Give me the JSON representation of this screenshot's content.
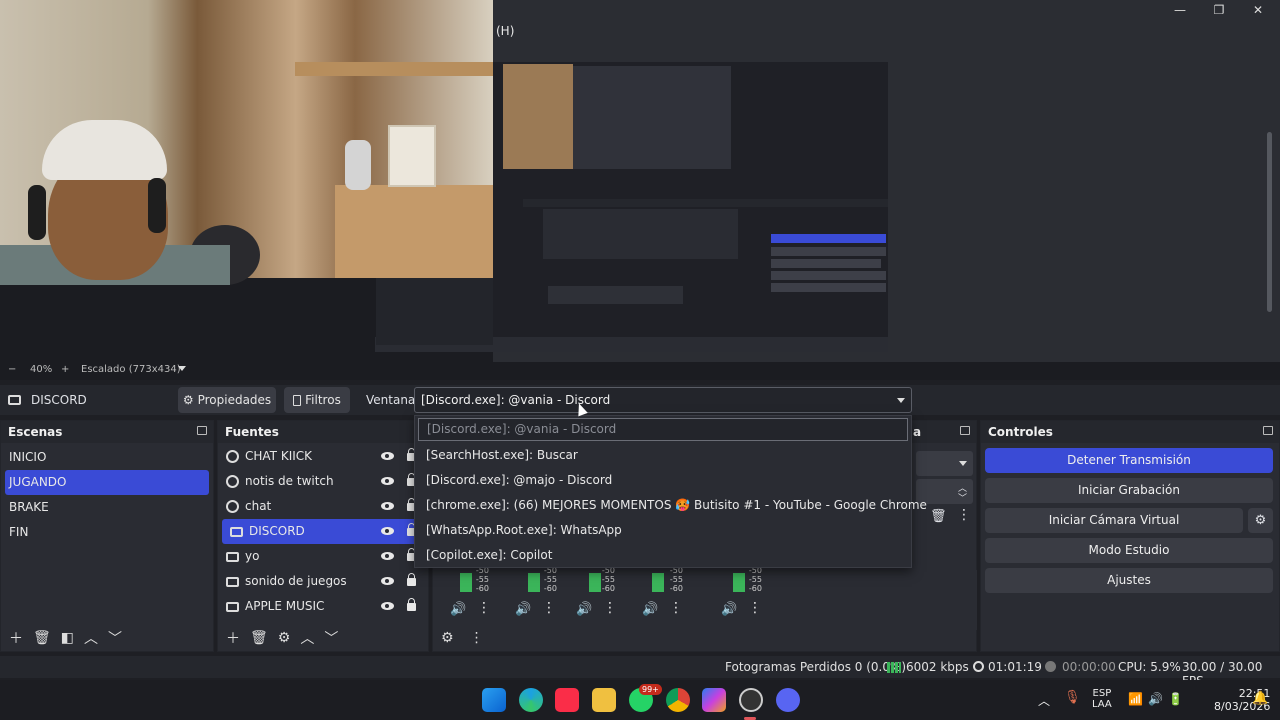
{
  "window": {
    "title_suffix": "(H)",
    "minimize_icon": "minimize-icon",
    "restore_icon": "restore-icon",
    "close_icon": "close-icon"
  },
  "preview": {
    "zoom_minus": "−",
    "zoom_level": "40%",
    "zoom_plus": "+",
    "scaling_label": "Escalado (773x434)"
  },
  "context_bar": {
    "source_name": "DISCORD",
    "properties_label": "Propiedades",
    "filters_label": "Filtros",
    "window_label": "Ventana",
    "window_value": "[Discord.exe]: @vania - Discord"
  },
  "window_dropdown": {
    "options": [
      "[Discord.exe]: @vania - Discord",
      "[SearchHost.exe]: Buscar",
      "[Discord.exe]: @majo - Discord",
      "[chrome.exe]: (66) MEJORES MOMENTOS 🥵 Butisito #1 - YouTube - Google Chrome",
      "[WhatsApp.Root.exe]: WhatsApp",
      "[Copilot.exe]: Copilot"
    ]
  },
  "scenes": {
    "title": "Escenas",
    "items": [
      "INICIO",
      "JUGANDO",
      "BRAKE",
      "FIN"
    ],
    "selected_index": 1
  },
  "sources": {
    "title": "Fuentes",
    "items": [
      "CHAT KIICK",
      "notis de twitch",
      "chat",
      "DISCORD",
      "yo",
      "sonido de juegos",
      "APPLE MUSIC"
    ],
    "selected_index": 3
  },
  "mixer": {
    "title_fragment": "a",
    "db_labels": [
      "-50",
      "-55",
      "-60"
    ]
  },
  "controls": {
    "title": "Controles",
    "stop_stream": "Detener Transmisión",
    "start_recording": "Iniciar Grabación",
    "start_virtual_cam": "Iniciar Cámara Virtual",
    "studio_mode": "Modo Estudio",
    "settings": "Ajustes"
  },
  "status": {
    "dropped_frames": "Fotogramas Perdidos 0 (0.0%)",
    "bitrate": "6002 kbps",
    "stream_time": "01:01:19",
    "rec_time": "00:00:00",
    "cpu": "CPU: 5.9%",
    "fps": "30.00 / 30.00 FPS"
  },
  "taskbar": {
    "lang_top": "ESP",
    "lang_bottom": "LAA",
    "time": "22:51",
    "date": "8/03/2026",
    "whatsapp_badge": "99+"
  },
  "colors": {
    "accent": "#3a4bd6",
    "panel": "#2a2c33",
    "meter_green": "#3bb55a"
  }
}
